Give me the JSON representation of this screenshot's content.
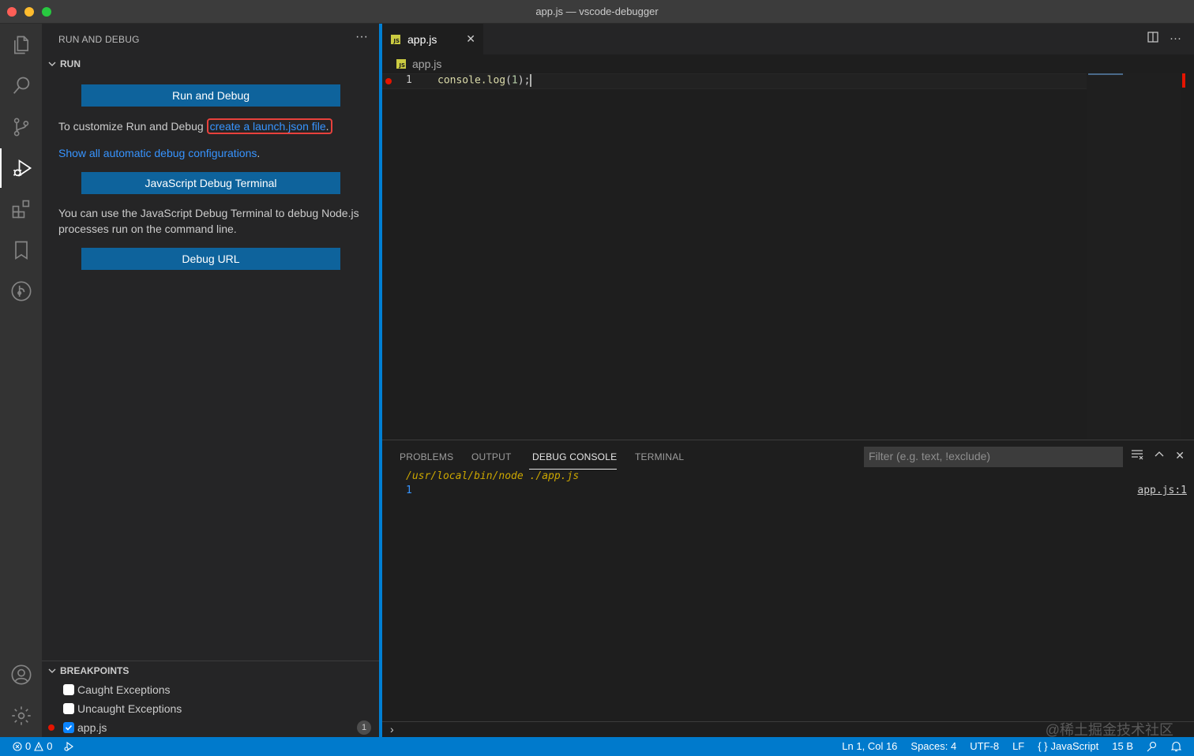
{
  "window": {
    "title": "app.js — vscode-debugger"
  },
  "sidebar": {
    "header": "RUN AND DEBUG",
    "more": "···",
    "run_section": "RUN",
    "run_button": "Run and Debug",
    "customize_text": "To customize Run and Debug",
    "customize_link": "create a launch.json file",
    "customize_suffix": ".",
    "show_all_link": "Show all automatic debug configurations",
    "show_all_suffix": ".",
    "js_terminal_button": "JavaScript Debug Terminal",
    "js_terminal_text": "You can use the JavaScript Debug Terminal to debug Node.js processes run on the command line.",
    "debug_url_button": "Debug URL",
    "breakpoints_section": "BREAKPOINTS",
    "breakpoints": [
      {
        "label": "Caught Exceptions",
        "checked": false
      },
      {
        "label": "Uncaught Exceptions",
        "checked": false
      },
      {
        "label": "app.js",
        "checked": true,
        "count": "1"
      }
    ]
  },
  "editor": {
    "tab_label": "app.js",
    "tab_icon": "JS",
    "breadcrumb": "app.js",
    "line_number": "1",
    "code_fn": "console.log",
    "code_open": "(",
    "code_num": "1",
    "code_close": ");",
    "breakpoint_color": "#e51400"
  },
  "panel": {
    "tabs": [
      "PROBLEMS",
      "OUTPUT",
      "DEBUG CONSOLE",
      "TERMINAL"
    ],
    "active_tab": "DEBUG CONSOLE",
    "filter_placeholder": "Filter (e.g. text, !exclude)",
    "console_cmd_path": "/usr/local/bin/node",
    "console_cmd_arg": "./app.js",
    "console_output": "1",
    "console_source": "app.js:1",
    "repl_prompt": "›",
    "watermark": "@稀土掘金技术社区"
  },
  "statusbar": {
    "errors": "0",
    "warnings": "0",
    "position": "Ln 1, Col 16",
    "spaces": "Spaces: 4",
    "encoding": "UTF-8",
    "eol": "LF",
    "language": "JavaScript",
    "size": "15 B",
    "accent": "#007acc"
  },
  "colors": {
    "accent": "#007acc",
    "button": "#0e639c",
    "link": "#3794ff",
    "highlight": "#e8413c"
  }
}
